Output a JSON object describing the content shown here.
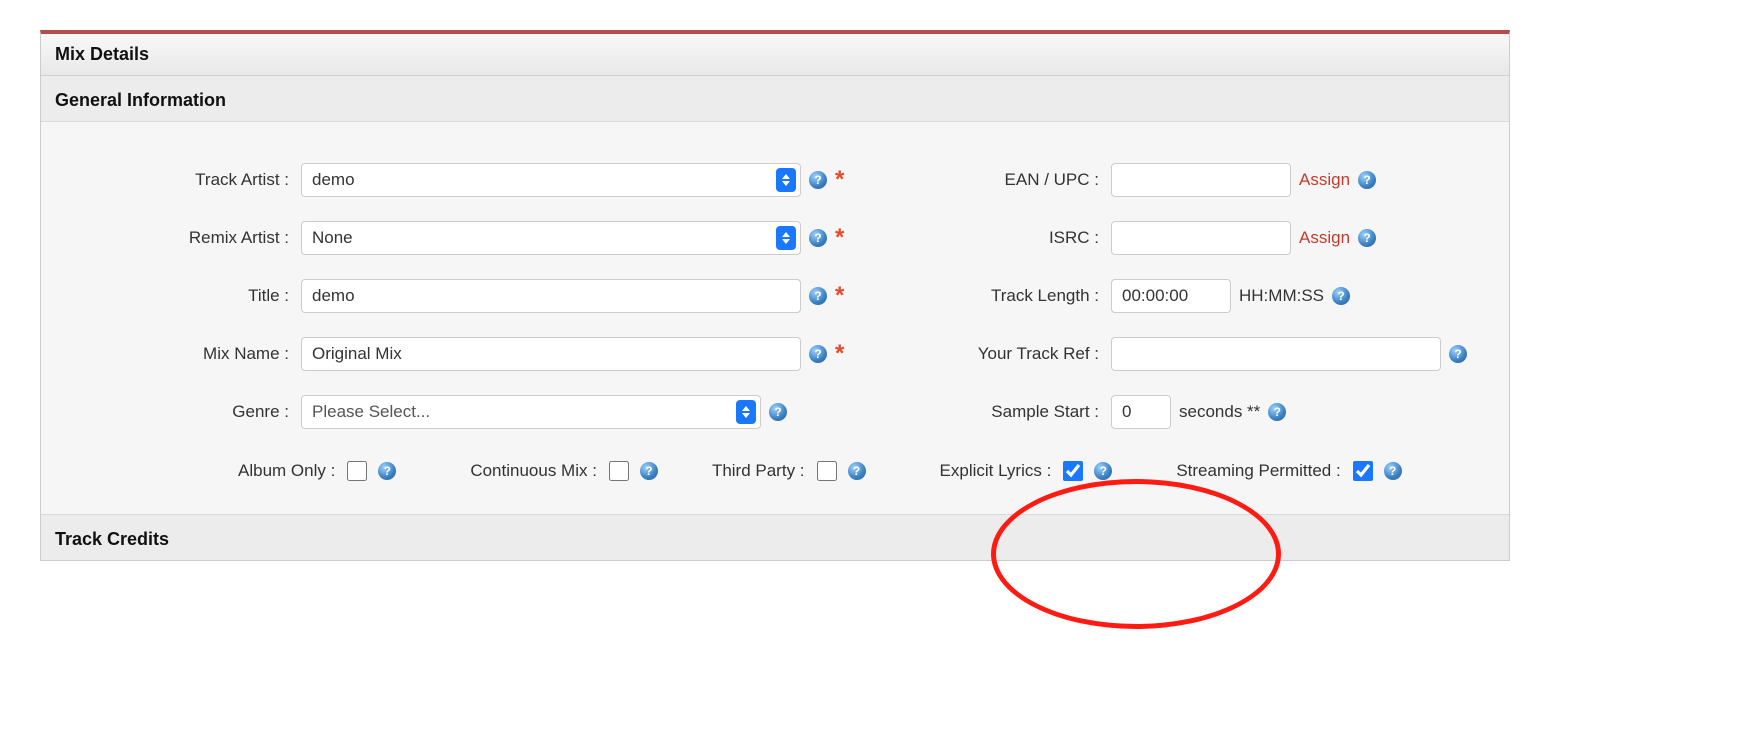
{
  "panel_title": "Mix Details",
  "sections": {
    "general": "General Information",
    "credits": "Track Credits"
  },
  "left": {
    "track_artist": {
      "label": "Track Artist :",
      "value": "demo"
    },
    "remix_artist": {
      "label": "Remix Artist :",
      "value": "None"
    },
    "title": {
      "label": "Title :",
      "value": "demo"
    },
    "mix_name": {
      "label": "Mix Name :",
      "value": "Original Mix"
    },
    "genre": {
      "label": "Genre :",
      "placeholder": "Please Select..."
    }
  },
  "right": {
    "ean": {
      "label": "EAN / UPC :",
      "assign": "Assign"
    },
    "isrc": {
      "label": "ISRC :",
      "assign": "Assign"
    },
    "track_length": {
      "label": "Track Length :",
      "value": "00:00:00",
      "hint": "HH:MM:SS"
    },
    "track_ref": {
      "label": "Your Track Ref :"
    },
    "sample_start": {
      "label": "Sample Start :",
      "value": "0",
      "hint": "seconds **"
    }
  },
  "bottom": {
    "album_only": {
      "label": "Album Only :",
      "checked": false
    },
    "continuous_mix": {
      "label": "Continuous Mix :",
      "checked": false
    },
    "third_party": {
      "label": "Third Party :",
      "checked": false
    },
    "explicit_lyrics": {
      "label": "Explicit Lyrics :",
      "checked": true
    },
    "streaming_permitted": {
      "label": "Streaming Permitted :",
      "checked": true
    }
  },
  "required_marker": "*",
  "help_glyph": "?"
}
